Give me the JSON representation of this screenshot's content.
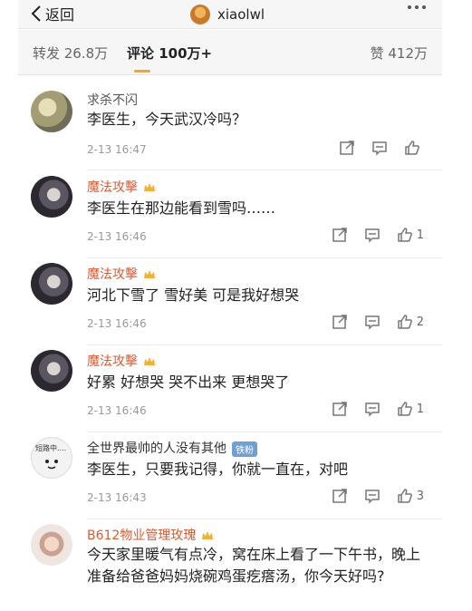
{
  "header": {
    "back_label": "返回",
    "username": "xiaolwl"
  },
  "tabs": {
    "repost": "转发 26.8万",
    "comment": "评论 100万+",
    "like": "赞 412万"
  },
  "comments": [
    {
      "name": "求杀不闪",
      "text": "李医生，今天武汉冷吗？",
      "time": "2-13 16:47",
      "likes": ""
    },
    {
      "name": "魔法攻擊",
      "text": "李医生在那边能看到雪吗……",
      "time": "2-13 16:46",
      "likes": "1"
    },
    {
      "name": "魔法攻擊",
      "text": "河北下雪了 雪好美 可是我好想哭",
      "time": "2-13 16:46",
      "likes": "2"
    },
    {
      "name": "魔法攻擊",
      "text": "好累 好想哭 哭不出来 更想哭了",
      "time": "2-13 16:46",
      "likes": "1"
    },
    {
      "name": "全世界最帅的人没有其他",
      "badge": "铁粉",
      "avatar_text": "短路中....",
      "text": "李医生，只要我记得，你就一直在，对吧",
      "time": "2-13 16:43",
      "likes": "3"
    },
    {
      "name": "B612物业管理玫瑰",
      "text": "今天家里暖气有点冷，窝在床上看了一下午书，晚上准备给爸爸妈妈烧碗鸡蛋疙瘩汤，你今天好吗?"
    }
  ],
  "colors": {
    "vip_name": "#e8572c",
    "tab_underline": "#f5a623"
  }
}
